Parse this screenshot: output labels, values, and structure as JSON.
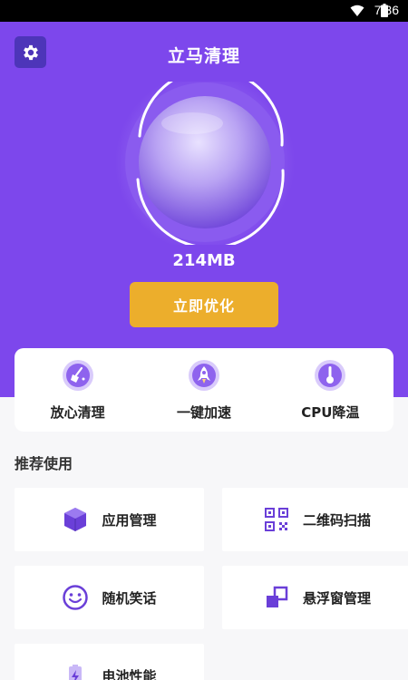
{
  "status_bar": {
    "time": "7:36"
  },
  "header": {
    "title": "立马清理"
  },
  "memory": {
    "value": "214MB"
  },
  "optimize_button": {
    "label": "立即优化"
  },
  "quick_actions": [
    {
      "label": "放心清理",
      "icon": "broom-icon"
    },
    {
      "label": "一键加速",
      "icon": "rocket-icon"
    },
    {
      "label": "CPU降温",
      "icon": "thermometer-icon"
    }
  ],
  "section": {
    "title": "推荐使用"
  },
  "tools": [
    {
      "label": "应用管理",
      "icon": "cube-icon"
    },
    {
      "label": "二维码扫描",
      "icon": "qr-code-icon"
    },
    {
      "label": "随机笑话",
      "icon": "smiley-icon"
    },
    {
      "label": "悬浮窗管理",
      "icon": "floating-window-icon"
    },
    {
      "label": "电池性能",
      "icon": "battery-icon"
    }
  ],
  "colors": {
    "brand": "#7d47ec",
    "accent": "#ecae2c",
    "icon": "#6a3fd8"
  }
}
